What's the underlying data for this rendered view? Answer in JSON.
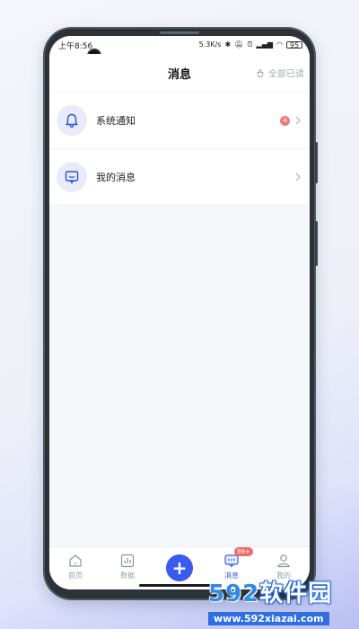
{
  "status_bar": {
    "time": "上午8:56",
    "network_speed": "5.3K/s",
    "battery": "95"
  },
  "header": {
    "title": "消息",
    "mark_all_read_label": "全部已读",
    "mark_all_read_icon": "broom-icon"
  },
  "messages": [
    {
      "label": "系统通知",
      "icon": "bell-icon",
      "badge": "4"
    },
    {
      "label": "我的消息",
      "icon": "chat-icon",
      "badge": ""
    }
  ],
  "tabbar": {
    "items": [
      {
        "label": "首页",
        "icon": "home-icon"
      },
      {
        "label": "数据",
        "icon": "chart-icon"
      },
      {
        "label": "",
        "icon": "plus-icon"
      },
      {
        "label": "消息",
        "icon": "message-icon",
        "badge": "99+"
      },
      {
        "label": "我的",
        "icon": "user-icon"
      }
    ]
  },
  "watermark": {
    "logo_num": "592",
    "logo_text": "软件园",
    "url": "www.592xiazai.com"
  },
  "colors": {
    "accent": "#3b5bf0",
    "badge": "#f06a6a",
    "icon_bg": "#e8ecf8"
  }
}
